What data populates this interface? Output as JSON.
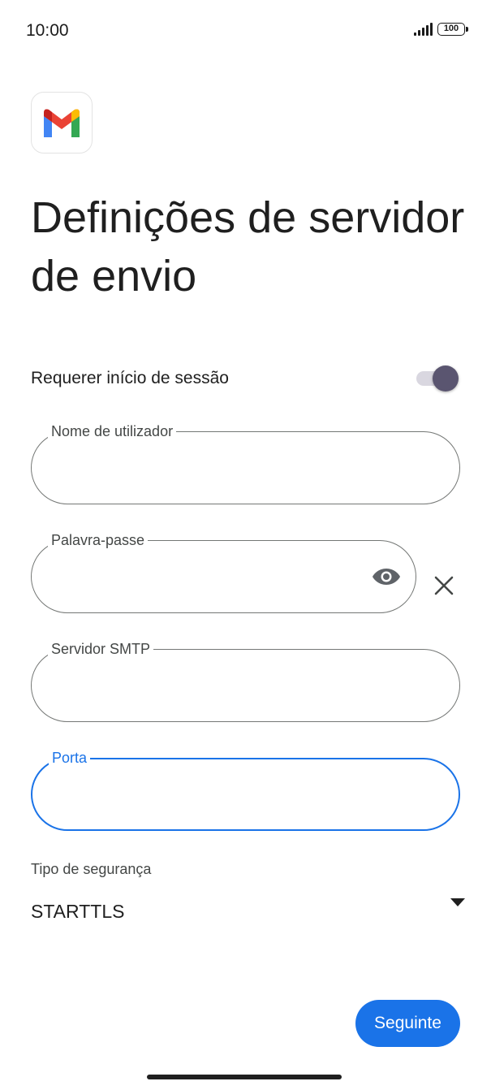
{
  "status_bar": {
    "time": "10:00",
    "battery": "100"
  },
  "app": {
    "logo_icon": "gmail-logo-icon"
  },
  "page": {
    "title": "Definições de servidor de envio"
  },
  "require_signin": {
    "label": "Requerer início de sessão",
    "enabled": true
  },
  "fields": {
    "username": {
      "label": "Nome de utilizador",
      "value": ""
    },
    "password": {
      "label": "Palavra-passe",
      "value": "",
      "toggle_icon": "eye-icon",
      "clear_icon": "close-icon"
    },
    "smtp_server": {
      "label": "Servidor SMTP",
      "value": ""
    },
    "port": {
      "label": "Porta",
      "value": "",
      "focused": true
    }
  },
  "security": {
    "label": "Tipo de segurança",
    "value": "STARTTLS",
    "icon": "dropdown-arrow-icon"
  },
  "actions": {
    "next_label": "Seguinte"
  },
  "colors": {
    "accent": "#1a73e8",
    "toggle_thumb": "#5a5570",
    "outline": "#747775"
  }
}
